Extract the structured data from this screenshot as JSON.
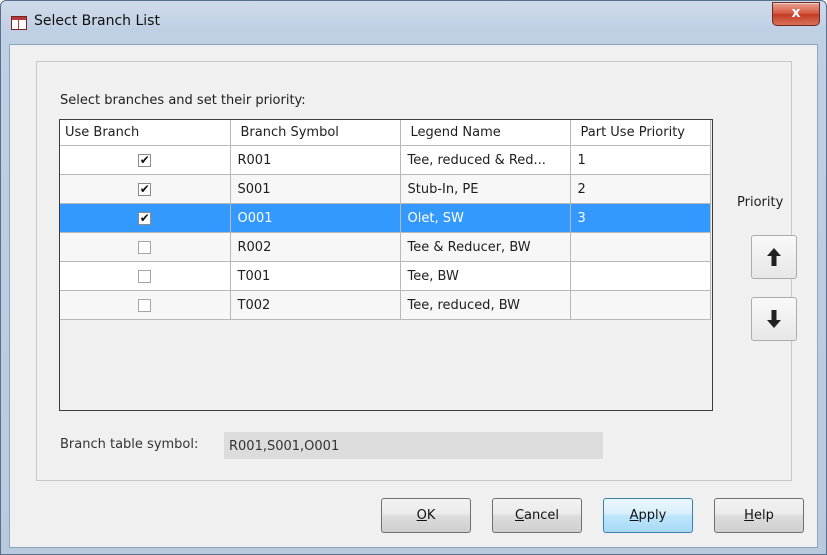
{
  "window": {
    "title": "Select Branch List",
    "close_glyph": "x"
  },
  "instructions": "Select branches and set their priority:",
  "table": {
    "columns": [
      "Use Branch",
      "Branch Symbol",
      "Legend Name",
      "Part Use Priority"
    ],
    "rows": [
      {
        "checked": true,
        "symbol": "R001",
        "legend": "Tee, reduced & Red...",
        "priority": "1"
      },
      {
        "checked": true,
        "symbol": "S001",
        "legend": "Stub-In, PE",
        "priority": "2"
      },
      {
        "checked": true,
        "symbol": "O001",
        "legend": "Olet, SW",
        "priority": "3",
        "selected": true
      },
      {
        "checked": false,
        "symbol": "R002",
        "legend": "Tee & Reducer, BW",
        "priority": ""
      },
      {
        "checked": false,
        "symbol": "T001",
        "legend": "Tee, BW",
        "priority": ""
      },
      {
        "checked": false,
        "symbol": "T002",
        "legend": "Tee, reduced, BW",
        "priority": ""
      }
    ]
  },
  "priority": {
    "label": "Priority",
    "up_icon": "arrow-up-icon",
    "down_icon": "arrow-down-icon"
  },
  "branch_table_symbol": {
    "label": "Branch table symbol:",
    "value": "R001,S001,O001"
  },
  "buttons": {
    "ok": {
      "mnemonic": "O",
      "rest": "K"
    },
    "cancel": {
      "mnemonic": "C",
      "rest": "ancel"
    },
    "apply": {
      "mnemonic": "A",
      "rest": "pply"
    },
    "help": {
      "mnemonic": "H",
      "rest": "elp"
    }
  },
  "colors": {
    "selection": "#3399ff",
    "dialog_bg": "#f0f0f0",
    "title_gradient": "#bfcfe4",
    "close_button": "#c43a22"
  }
}
